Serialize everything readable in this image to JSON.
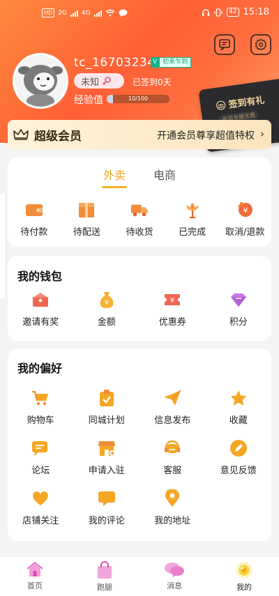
{
  "status_bar": {
    "left_chip": "HD",
    "signal_1": "2G",
    "signal_2": "4G",
    "battery": "42",
    "time": "15:18"
  },
  "profile": {
    "username": "tc_16703234",
    "vip_letter": "V",
    "vip_tag": "初来乍到",
    "gender": "未知",
    "signed_in": "已签到0天",
    "exp_label": "经验值",
    "exp_text": "10/100",
    "exp_progress": 0.1
  },
  "signin_card": {
    "title": "签到有礼",
    "sub": "会员专属优惠"
  },
  "vip": {
    "title": "超级会员",
    "desc": "开通会员尊享超值特权",
    "chevron": "›"
  },
  "orders": {
    "tabs": [
      "外卖",
      "电商"
    ],
    "active_tab": 0,
    "items": [
      {
        "label": "待付款",
        "icon": "wallet-icon"
      },
      {
        "label": "待配送",
        "icon": "package-icon"
      },
      {
        "label": "待收货",
        "icon": "truck-icon"
      },
      {
        "label": "已完成",
        "icon": "flower-icon"
      },
      {
        "label": "取消/退款",
        "icon": "refund-icon"
      }
    ]
  },
  "wallet": {
    "title": "我的钱包",
    "items": [
      {
        "label": "邀请有奖",
        "icon": "invite-mail-icon"
      },
      {
        "label": "金额",
        "icon": "money-bag-icon"
      },
      {
        "label": "优惠券",
        "icon": "coupon-icon"
      },
      {
        "label": "积分",
        "icon": "gem-icon"
      }
    ]
  },
  "preferences": {
    "title": "我的偏好",
    "items": [
      {
        "label": "购物车",
        "icon": "cart-icon"
      },
      {
        "label": "同城计划",
        "icon": "clipboard-check-icon"
      },
      {
        "label": "信息发布",
        "icon": "send-icon"
      },
      {
        "label": "收藏",
        "icon": "star-icon"
      },
      {
        "label": "论坛",
        "icon": "forum-icon"
      },
      {
        "label": "申请入驻",
        "icon": "store-icon"
      },
      {
        "label": "客服",
        "icon": "headset-icon"
      },
      {
        "label": "意见反馈",
        "icon": "pen-icon"
      },
      {
        "label": "店铺关注",
        "icon": "heart-icon"
      },
      {
        "label": "我的评论",
        "icon": "comment-icon"
      },
      {
        "label": "我的地址",
        "icon": "location-pin-icon"
      }
    ]
  },
  "tabbar": [
    {
      "label": "首页",
      "icon": "home-icon"
    },
    {
      "label": "跑腿",
      "icon": "shopping-bag-icon"
    },
    {
      "label": "消息",
      "icon": "chat-bubbles-icon"
    },
    {
      "label": "我的",
      "icon": "profile-icon"
    }
  ],
  "colors": {
    "accent": "#f3b21f",
    "header_start": "#ff8a3d",
    "header_end": "#ff5f35",
    "icon_orange": "#f39a2a",
    "icon_red": "#f0654f"
  }
}
